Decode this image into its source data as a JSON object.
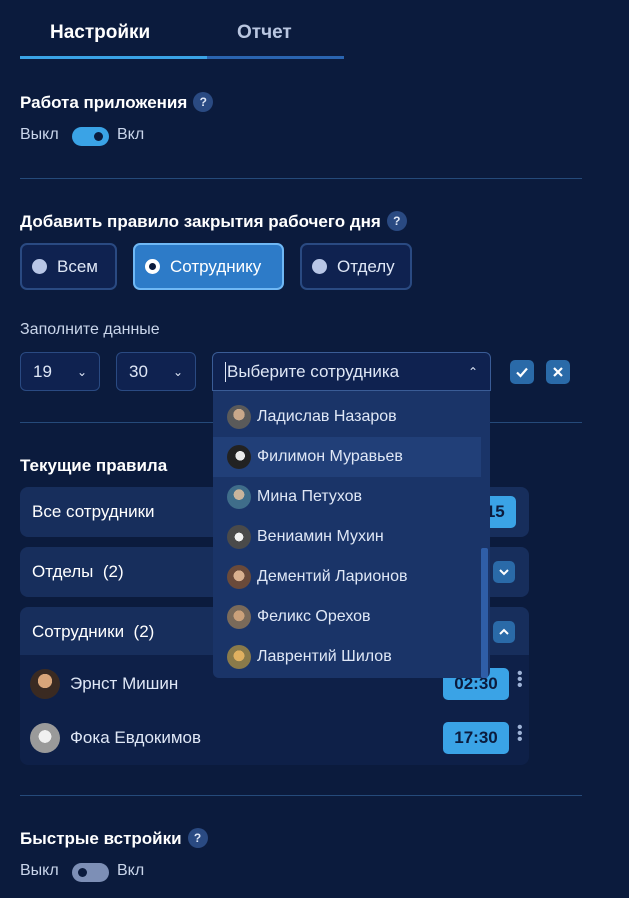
{
  "tabs": [
    {
      "label": "Настройки",
      "active": true
    },
    {
      "label": "Отчет",
      "active": false
    }
  ],
  "colors": {
    "background": "#0b1b3d",
    "accent": "#3aa3e6",
    "selected_option": "#2d7bc8",
    "panel": "#172e5c"
  },
  "app_work": {
    "title": "Работа приложения",
    "help": "?",
    "off_label": "Выкл",
    "on_label": "Вкл",
    "enabled": true
  },
  "add_rule": {
    "title": "Добавить правило закрытия рабочего дня",
    "help": "?",
    "options": [
      {
        "label": "Всем",
        "selected": false
      },
      {
        "label": "Сотруднику",
        "selected": true
      },
      {
        "label": "Отделу",
        "selected": false
      }
    ],
    "fill_label": "Заполните данные",
    "hour": "19",
    "minute": "30",
    "employee_placeholder": "Выберите сотрудника",
    "confirm_icon": "check-icon",
    "cancel_icon": "close-icon"
  },
  "employee_dropdown": {
    "items": [
      {
        "name": "Ладислав Назаров"
      },
      {
        "name": "Филимон Муравьев",
        "highlighted": true
      },
      {
        "name": "Мина Петухов"
      },
      {
        "name": "Вениамин Мухин"
      },
      {
        "name": "Дементий Ларионов"
      },
      {
        "name": "Феликс Орехов"
      },
      {
        "name": "Лаврентий Шилов"
      }
    ]
  },
  "current_rules": {
    "title": "Текущие правила",
    "all_employees": {
      "label": "Все сотрудники",
      "time": "17:15"
    },
    "departments": {
      "label": "Отделы",
      "count": "(2)",
      "expanded": false
    },
    "employees": {
      "label": "Сотрудники",
      "count": "(2)",
      "expanded": true,
      "rows": [
        {
          "name": "Эрнст Мишин",
          "time": "02:30"
        },
        {
          "name": "Фока Евдокимов",
          "time": "17:30"
        }
      ]
    }
  },
  "quick_settings": {
    "title": "Быстрые встройки",
    "help": "?",
    "off_label": "Выкл",
    "on_label": "Вкл",
    "enabled": false
  }
}
